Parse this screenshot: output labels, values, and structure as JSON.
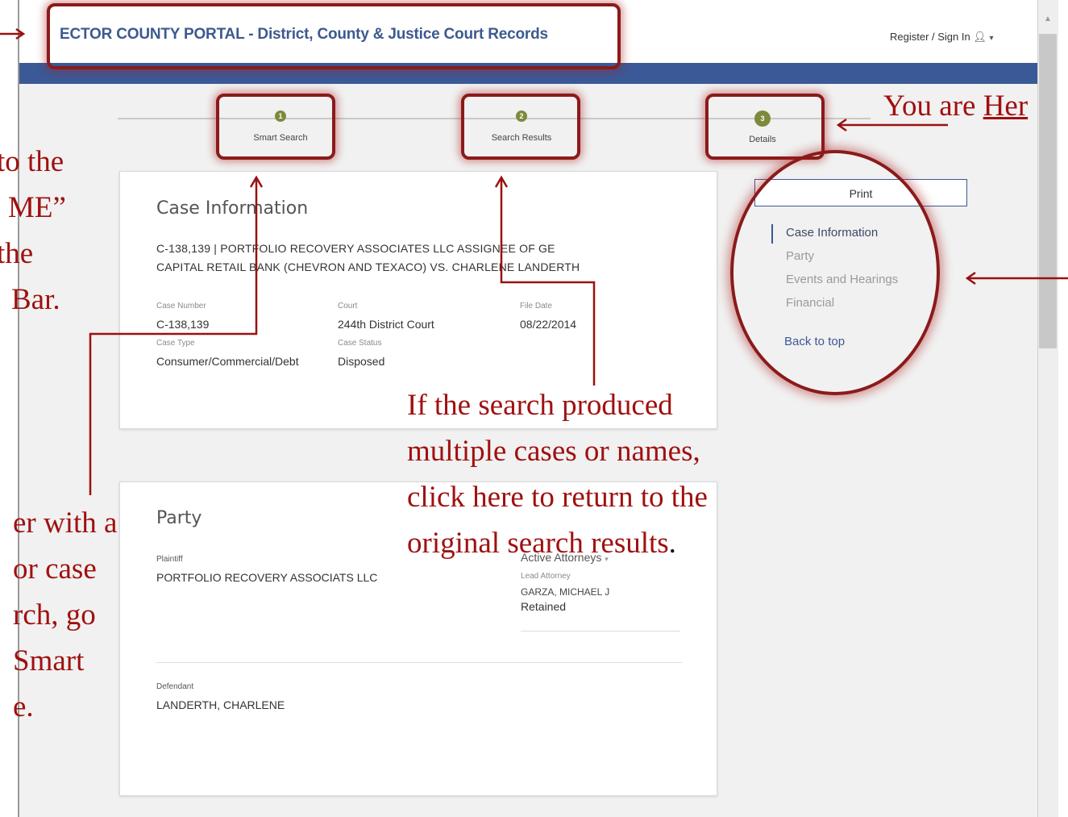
{
  "portal": {
    "title": "ECTOR COUNTY PORTAL - District, County & Justice Court Records",
    "register_label": "Register / Sign In"
  },
  "steps": [
    {
      "number": "1",
      "label": "Smart Search"
    },
    {
      "number": "2",
      "label": "Search Results"
    },
    {
      "number": "3",
      "label": "Details"
    }
  ],
  "case_info": {
    "title": "Case Information",
    "case_line1": "C-138,139 | PORTFOLIO RECOVERY ASSOCIATES LLC ASSIGNEE OF GE",
    "case_line2": "CAPITAL RETAIL BANK (CHEVRON AND TEXACO) VS. CHARLENE LANDERTH",
    "case_number_label": "Case Number",
    "case_number": "C-138,139",
    "court_label": "Court",
    "court": "244th District Court",
    "file_date_label": "File Date",
    "file_date": "08/22/2014",
    "case_type_label": "Case Type",
    "case_type": "Consumer/Commercial/Debt",
    "case_status_label": "Case Status",
    "case_status": "Disposed"
  },
  "party": {
    "title": "Party",
    "plaintiff_label": "Plaintiff",
    "plaintiff": "PORTFOLIO RECOVERY ASSOCIATS LLC",
    "active_attorneys_label": "Active Attorneys",
    "lead_attorney_label": "Lead Attorney",
    "lead_attorney": "GARZA, MICHAEL J",
    "attorney_status": "Retained",
    "defendant_label": "Defendant",
    "defendant": "LANDERTH, CHARLENE"
  },
  "side_nav": {
    "print_label": "Print",
    "items": [
      "Case Information",
      "Party",
      "Events and Hearings",
      "Financial"
    ],
    "back_to_top": "Back to top"
  },
  "annotations": {
    "you_are": "You are",
    "here": "Her",
    "left_top": [
      "to the",
      "ME”",
      "the",
      "Bar."
    ],
    "left_bottom": [
      "er with a",
      "or case",
      "rch, go",
      "Smart",
      "e."
    ],
    "center": [
      "If the search produced",
      "multiple cases or names,",
      "click here to return to the",
      "original search results",
      "."
    ]
  },
  "colors": {
    "brand_blue": "#3b5996",
    "annotation_red": "#a01010",
    "step_green": "#7d8a3c"
  }
}
